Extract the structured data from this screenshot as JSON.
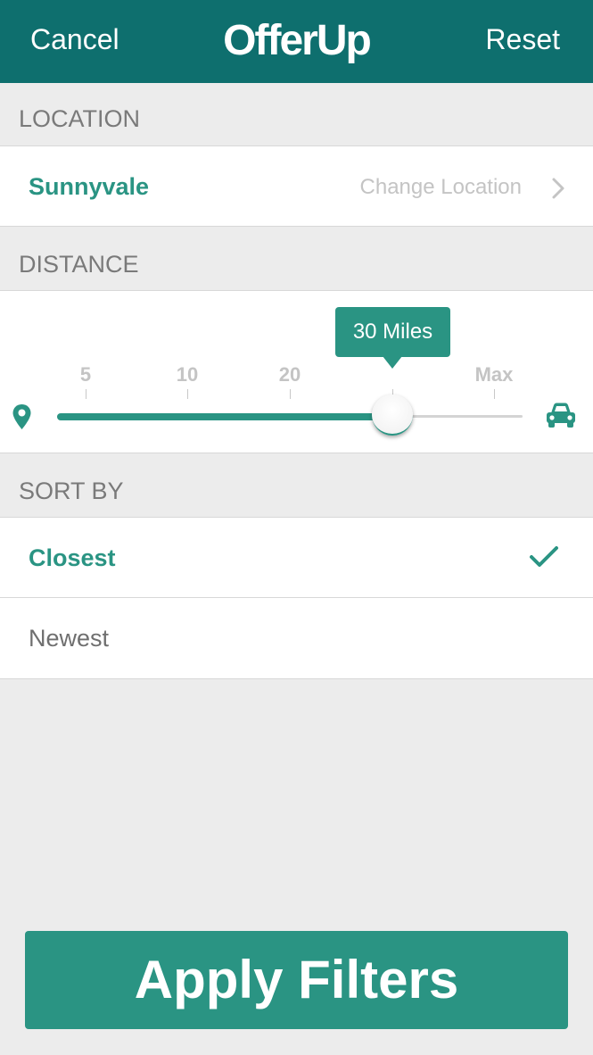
{
  "navbar": {
    "cancel_label": "Cancel",
    "logo_text": "OfferUp",
    "reset_label": "Reset",
    "color": "#0e6f6e"
  },
  "location": {
    "header": "LOCATION",
    "city": "Sunnyvale",
    "change_label": "Change Location"
  },
  "distance": {
    "header": "DISTANCE",
    "selected_label": "30 Miles",
    "ticks": [
      "5",
      "10",
      "20",
      "Max"
    ],
    "selected_fraction": 0.72
  },
  "sort": {
    "header": "SORT BY",
    "options": [
      {
        "label": "Closest",
        "selected": true
      },
      {
        "label": "Newest",
        "selected": false
      }
    ]
  },
  "apply_button": {
    "label": "Apply Filters"
  },
  "colors": {
    "accent": "#2a9483",
    "background": "#ececec"
  },
  "icons": [
    "chevron-right-icon",
    "location-pin-icon",
    "car-icon",
    "checkmark-icon"
  ]
}
